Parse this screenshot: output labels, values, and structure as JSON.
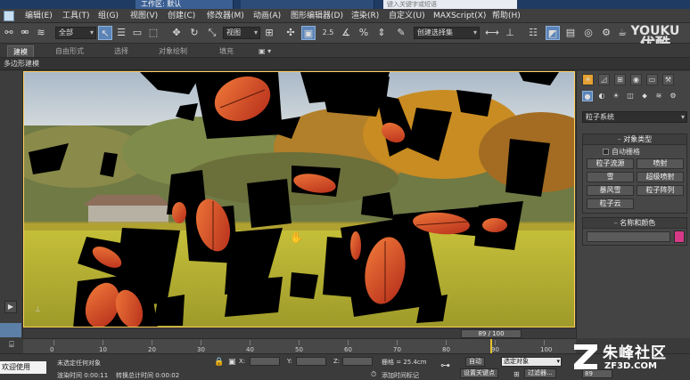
{
  "titlebar": {
    "workspace_tab": "工作区: 默认",
    "search_placeholder": "键入关键字或短语"
  },
  "menu": {
    "items": [
      "编辑(E)",
      "工具(T)",
      "组(G)",
      "视图(V)",
      "创建(C)",
      "修改器(M)",
      "动画(A)",
      "图形编辑器(D)",
      "渲染(R)",
      "自定义(U)",
      "MAXScript(X)",
      "帮助(H)"
    ]
  },
  "toolbar": {
    "filter_value": "全部",
    "coord_value": "视图",
    "selection_set_placeholder": "创建选择集",
    "icons": [
      "link-icon",
      "unlink-icon",
      "bind-space-warp-icon",
      "select-object-icon",
      "select-by-name-icon",
      "rect-region-icon",
      "window-crossing-icon",
      "move-icon",
      "rotate-icon",
      "scale-icon",
      "pivot-icon",
      "snap-2-5-icon",
      "angle-snap-icon",
      "percent-snap-icon",
      "spinner-snap-icon",
      "mirror-icon",
      "align-icon",
      "layer-manager-icon",
      "curve-editor-icon",
      "schematic-view-icon",
      "material-editor-icon",
      "render-setup-icon",
      "render-frame-icon",
      "render-icon"
    ]
  },
  "ribbon": {
    "tabs": [
      "建模",
      "自由形式",
      "选择",
      "对象绘制",
      "填充"
    ],
    "active_tab": "建模",
    "subtitle": "多边形建模"
  },
  "command_panel": {
    "category_dropdown": "粒子系统",
    "object_type": {
      "title": "对象类型",
      "auto_grid": "自动栅格",
      "buttons": [
        "粒子流源",
        "喷射",
        "雪",
        "超级喷射",
        "暴风雪",
        "粒子阵列",
        "粒子云"
      ]
    },
    "name_color": {
      "title": "名称和颜色",
      "swatch_color": "#d63a87"
    }
  },
  "timeline": {
    "frame_display": "89 / 100",
    "current_frame": 89,
    "total_frames": 100,
    "tick_labels": [
      "0",
      "10",
      "20",
      "30",
      "40",
      "50",
      "60",
      "70",
      "80",
      "90",
      "100"
    ]
  },
  "status": {
    "welcome": "欢迎使用",
    "selection_text": "未选定任何对象",
    "render_time": "渲染时间 0:00:11",
    "transform_time": "转换总计时间 0:00:02",
    "x_label": "X:",
    "y_label": "Y:",
    "z_label": "Z:",
    "grid": "栅格 = 25.4cm",
    "auto_key": "自动",
    "set_key": "设置关键点",
    "selected_filter": "选定对象",
    "add_time_tag": "添加时间标记",
    "filters": "过滤器...",
    "frame_value": "89"
  },
  "watermarks": {
    "youku_en": "YOUKU",
    "youku_cn": "优酷",
    "zf_name": "朱峰社区",
    "zf_url": "ZF3D.COM"
  }
}
